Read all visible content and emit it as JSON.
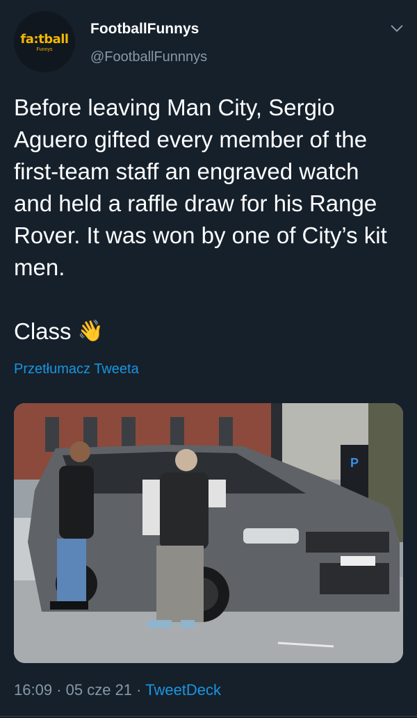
{
  "header": {
    "avatar_brand": "fa:tball",
    "avatar_sub": "Funnys",
    "display_name": "FootballFunnys",
    "handle": "@FootballFunnnys",
    "menu_icon": "chevron-down-icon"
  },
  "tweet": {
    "text": "Before leaving Man City, Sergio Aguero gifted every member of the first-team staff an engraved watch and held a raffle draw for his Range Rover. It was won by one of City’s kit men.\n\nClass",
    "emoji": "👋",
    "translate_label": "Przetłumacz Tweeta"
  },
  "meta": {
    "time": "16:09",
    "separator": "·",
    "date": "05 cze 21",
    "source": "TweetDeck"
  },
  "colors": {
    "background": "#15202b",
    "secondary_text": "#8899a6",
    "link": "#1b95e0"
  }
}
